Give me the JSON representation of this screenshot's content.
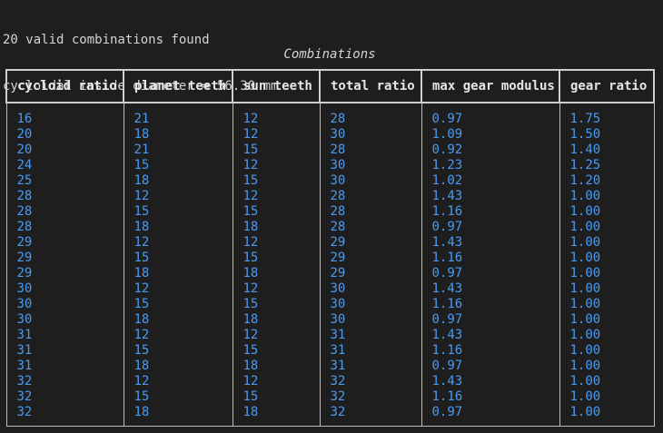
{
  "terminal": {
    "status_lines": [
      "20 valid combinations found",
      "cycloidal inside diameter = 56.30 mm"
    ]
  },
  "table": {
    "caption": "Combinations",
    "headers": [
      "cycloid ratio",
      "planet teeth",
      "sun teeth",
      "total ratio",
      "max gear modulus",
      "gear ratio"
    ],
    "rows": [
      [
        "16",
        "21",
        "12",
        "28",
        "0.97",
        "1.75"
      ],
      [
        "20",
        "18",
        "12",
        "30",
        "1.09",
        "1.50"
      ],
      [
        "20",
        "21",
        "15",
        "28",
        "0.92",
        "1.40"
      ],
      [
        "24",
        "15",
        "12",
        "30",
        "1.23",
        "1.25"
      ],
      [
        "25",
        "18",
        "15",
        "30",
        "1.02",
        "1.20"
      ],
      [
        "28",
        "12",
        "12",
        "28",
        "1.43",
        "1.00"
      ],
      [
        "28",
        "15",
        "15",
        "28",
        "1.16",
        "1.00"
      ],
      [
        "28",
        "18",
        "18",
        "28",
        "0.97",
        "1.00"
      ],
      [
        "29",
        "12",
        "12",
        "29",
        "1.43",
        "1.00"
      ],
      [
        "29",
        "15",
        "15",
        "29",
        "1.16",
        "1.00"
      ],
      [
        "29",
        "18",
        "18",
        "29",
        "0.97",
        "1.00"
      ],
      [
        "30",
        "12",
        "12",
        "30",
        "1.43",
        "1.00"
      ],
      [
        "30",
        "15",
        "15",
        "30",
        "1.16",
        "1.00"
      ],
      [
        "30",
        "18",
        "18",
        "30",
        "0.97",
        "1.00"
      ],
      [
        "31",
        "12",
        "12",
        "31",
        "1.43",
        "1.00"
      ],
      [
        "31",
        "15",
        "15",
        "31",
        "1.16",
        "1.00"
      ],
      [
        "31",
        "18",
        "18",
        "31",
        "0.97",
        "1.00"
      ],
      [
        "32",
        "12",
        "12",
        "32",
        "1.43",
        "1.00"
      ],
      [
        "32",
        "15",
        "15",
        "32",
        "1.16",
        "1.00"
      ],
      [
        "32",
        "18",
        "18",
        "32",
        "0.97",
        "1.00"
      ]
    ]
  },
  "colors": {
    "background": "#1e1e1e",
    "text": "#d4d4d4",
    "cell_value": "#4a9bf0",
    "border": "#cfcfcf"
  }
}
